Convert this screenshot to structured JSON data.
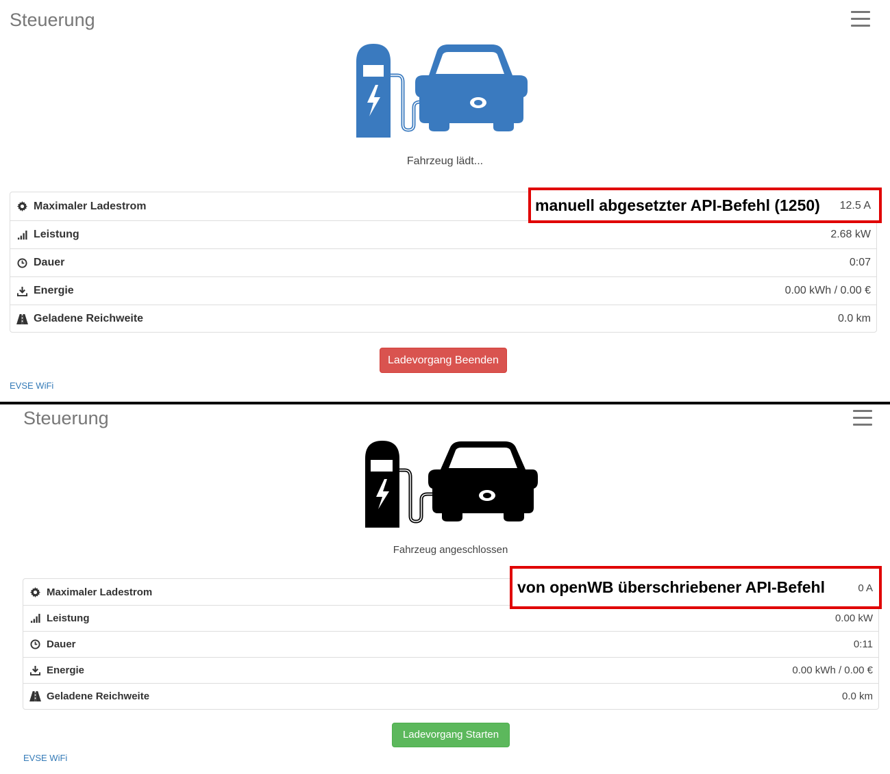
{
  "colors": {
    "charging_icon": "#3a7abf",
    "connected_icon": "#000000",
    "annotation_border": "#e00000",
    "stop_button": "#d9534f",
    "start_button": "#5cb85c",
    "link": "#337ab7"
  },
  "top": {
    "title": "Steuerung",
    "status": "Fahrzeug lädt...",
    "annotation": "manuell abgesetzter API-Befehl (1250)",
    "rows": [
      {
        "icon": "gear-icon",
        "label": "Maximaler Ladestrom",
        "value": "12.5 A"
      },
      {
        "icon": "signal-icon",
        "label": "Leistung",
        "value": "2.68 kW"
      },
      {
        "icon": "clock-icon",
        "label": "Dauer",
        "value": "0:07"
      },
      {
        "icon": "download-icon",
        "label": "Energie",
        "value": "0.00 kWh / 0.00 €"
      },
      {
        "icon": "road-icon",
        "label": "Geladene Reichweite",
        "value": "0.0 km"
      }
    ],
    "button": "Ladevorgang Beenden",
    "footer": "EVSE WiFi"
  },
  "bottom": {
    "title": "Steuerung",
    "status": "Fahrzeug angeschlossen",
    "annotation": "von openWB überschriebener API-Befehl",
    "rows": [
      {
        "icon": "gear-icon",
        "label": "Maximaler Ladestrom",
        "value": "0 A"
      },
      {
        "icon": "signal-icon",
        "label": "Leistung",
        "value": "0.00 kW"
      },
      {
        "icon": "clock-icon",
        "label": "Dauer",
        "value": "0:11"
      },
      {
        "icon": "download-icon",
        "label": "Energie",
        "value": "0.00 kWh / 0.00 €"
      },
      {
        "icon": "road-icon",
        "label": "Geladene Reichweite",
        "value": "0.0 km"
      }
    ],
    "button": "Ladevorgang Starten",
    "footer": "EVSE WiFi"
  }
}
